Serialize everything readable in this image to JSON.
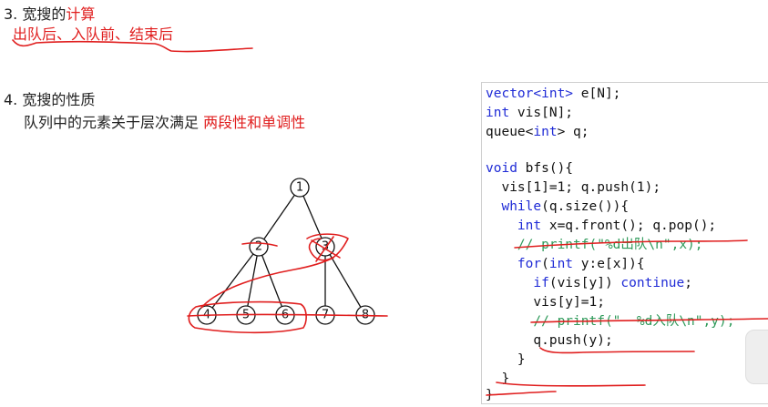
{
  "section3": {
    "prefix": "3. 宽搜的",
    "highlight": "计算",
    "subtitle": "出队后、入队前、结束后"
  },
  "section4": {
    "title": "4. 宽搜的性质",
    "desc_prefix": "队列中的元素关于层次满足",
    "desc_highlight": "两段性和单调性"
  },
  "tree": {
    "labels": [
      "1",
      "2",
      "3",
      "4",
      "5",
      "6",
      "7",
      "8"
    ]
  },
  "code": {
    "l1_kw": "vector<int>",
    "l1_rest": " e[N];",
    "l2_kw": "int",
    "l2_rest": " vis[N];",
    "l3_a": "queue<",
    "l3_kw": "int",
    "l3_b": "> q;",
    "l4_kw": "void",
    "l4_rest": " bfs(){",
    "l5": "  vis[1]=1; q.push(1);",
    "l6_kw": "  while",
    "l6_rest": "(q.size()){",
    "l7_kw": "    int",
    "l7_rest": " x=q.front(); q.pop();",
    "l8": "    // printf(\"%d出队\\n\",x);",
    "l9_kw": "    for",
    "l9_b": "(",
    "l9_kw2": "int",
    "l9_rest": " y:e[x]){",
    "l10_kw": "      if",
    "l10_mid": "(vis[y]) ",
    "l10_kw2": "continue",
    "l10_end": ";",
    "l11": "      vis[y]=1;",
    "l12": "      // printf(\"  %d入队\\n\",y);",
    "l13": "      q.push(y);",
    "l14": "    }",
    "l15": "  }",
    "l16": "}"
  },
  "colors": {
    "ink": "#e01e1e",
    "keyword": "#1f2bd6",
    "comment": "#2e9a5a"
  }
}
